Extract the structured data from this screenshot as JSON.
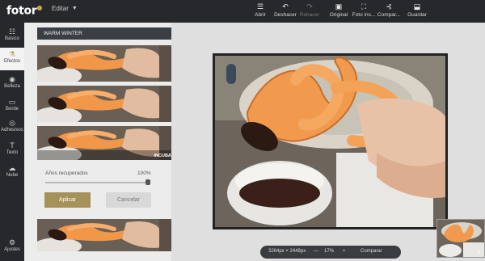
{
  "app": {
    "logo": "fotor",
    "menu_label": "Editar"
  },
  "toolbar": {
    "items": [
      {
        "label": "Abrir",
        "icon": "menu-icon",
        "glyph": "☰",
        "enabled": true
      },
      {
        "label": "Deshacer",
        "icon": "undo-icon",
        "glyph": "↶",
        "enabled": true
      },
      {
        "label": "Rehacer",
        "icon": "redo-icon",
        "glyph": "↷",
        "enabled": false
      },
      {
        "label": "Original",
        "icon": "image-icon",
        "glyph": "▣",
        "enabled": true
      },
      {
        "label": "Foto ins...",
        "icon": "crop-frame-icon",
        "glyph": "⛶",
        "enabled": true
      },
      {
        "label": "Compar...",
        "icon": "share-icon",
        "glyph": "⊰",
        "enabled": true
      },
      {
        "label": "Guardar",
        "icon": "save-icon",
        "glyph": "⬓",
        "enabled": true
      }
    ]
  },
  "sidebar": {
    "items": [
      {
        "label": "Básico",
        "icon": "sliders-icon",
        "glyph": "☷",
        "active": false
      },
      {
        "label": "Efectos",
        "icon": "flask-icon",
        "glyph": "⚗",
        "active": true
      },
      {
        "label": "Belleza",
        "icon": "eye-icon",
        "glyph": "◉",
        "active": false
      },
      {
        "label": "Borde",
        "icon": "frame-icon",
        "glyph": "▭",
        "active": false
      },
      {
        "label": "Adhesivos",
        "icon": "sticker-icon",
        "glyph": "◎",
        "active": false
      },
      {
        "label": "Texto",
        "icon": "text-icon",
        "glyph": "T",
        "active": false
      },
      {
        "label": "Nube",
        "icon": "cloud-icon",
        "glyph": "☁",
        "active": false
      }
    ],
    "bottom": {
      "label": "Ajustes",
      "icon": "gear-icon",
      "glyph": "⚙"
    }
  },
  "panel": {
    "header": "WARM WINTER",
    "close_glyph": "—",
    "thumbs": [
      {
        "label": ""
      },
      {
        "label": ""
      },
      {
        "label": "INCUBATOR"
      },
      {
        "label": ""
      }
    ],
    "slider": {
      "label": "Años recuperados",
      "value_text": "100%",
      "value": 1.0
    },
    "apply_label": "Aplicar",
    "cancel_label": "Cancelar"
  },
  "status": {
    "dimensions": "3264px × 2448px",
    "zoom_out": "—",
    "zoom": "17%",
    "zoom_in": "+",
    "compare": "Comparar"
  },
  "colors": {
    "accent": "#a6915b",
    "topbar": "#26282b",
    "panel_head": "#3b3e43"
  }
}
